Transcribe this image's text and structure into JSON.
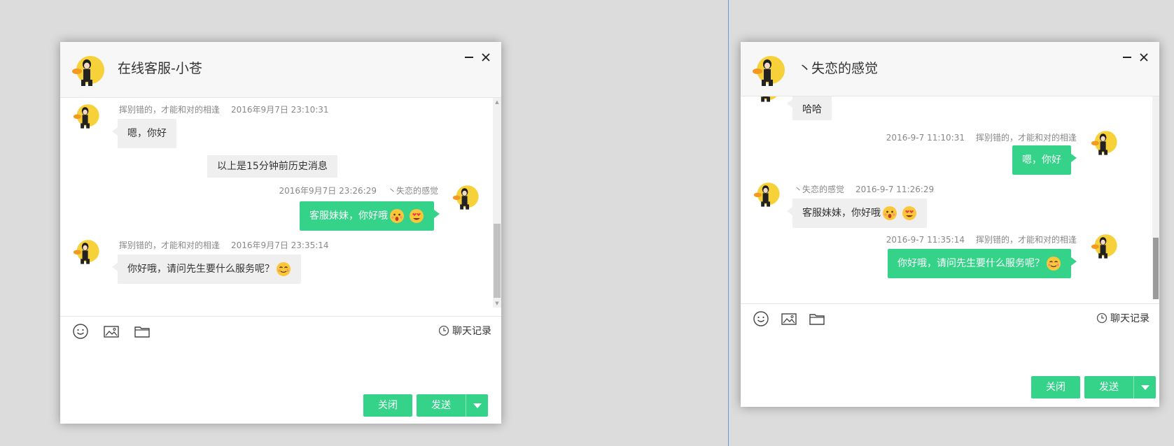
{
  "left_window": {
    "title": "在线客服-小苍",
    "messages": [
      {
        "sender": "挥别错的，才能和对的相逢",
        "time": "2016年9月7日 23:10:31",
        "text": "嗯，你好"
      },
      {
        "note": "以上是15分钟前历史消息"
      },
      {
        "sender": "丶失恋的感觉",
        "time": "2016年9月7日 23:26:29",
        "text": "客服妹妹，你好哦"
      },
      {
        "sender": "挥别错的，才能和对的相逢",
        "time": "2016年9月7日 23:35:14",
        "text": "你好哦，请问先生要什么服务呢？"
      }
    ],
    "history_label": "聊天记录",
    "close_label": "关闭",
    "send_label": "发送"
  },
  "right_window": {
    "title": "丶失恋的感觉",
    "messages": [
      {
        "text": "哈哈"
      },
      {
        "sender": "挥别错的，才能和对的相逢",
        "time": "2016-9-7 11:10:31",
        "text": "嗯，你好"
      },
      {
        "sender": "丶失恋的感觉",
        "time": "2016-9-7 11:26:29",
        "text": "客服妹妹，你好哦"
      },
      {
        "sender": "挥别错的，才能和对的相逢",
        "time": "2016-9-7 11:35:14",
        "text": "你好哦，请问先生要什么服务呢？"
      }
    ],
    "history_label": "聊天记录",
    "close_label": "关闭",
    "send_label": "发送"
  },
  "icons": [
    "avatar-duck-icon",
    "minimize-icon",
    "close-icon",
    "emoji-icon",
    "image-icon",
    "folder-icon",
    "clock-icon",
    "dropdown-arrow-icon"
  ],
  "colors": {
    "accent": "#35d38a",
    "incoming_bubble": "#efefef",
    "header_bg": "#f7f7f7",
    "desktop_bg": "#dcdcdc"
  }
}
